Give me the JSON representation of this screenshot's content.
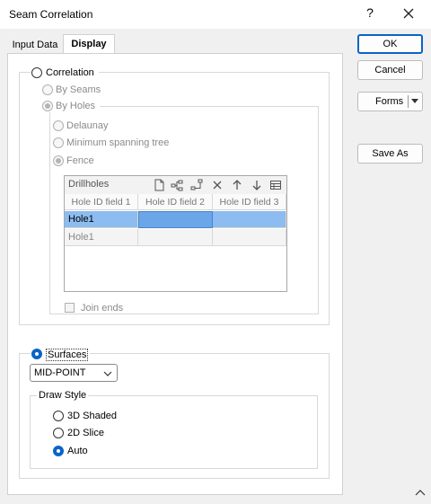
{
  "window": {
    "title": "Seam Correlation",
    "help_label": "?"
  },
  "tabs": [
    {
      "label": "Input Data"
    },
    {
      "label": "Display"
    }
  ],
  "correlation": {
    "label": "Correlation",
    "by_seams": "By Seams",
    "by_holes": "By Holes",
    "methods": {
      "delaunay": "Delaunay",
      "mst": "Minimum spanning tree",
      "fence": "Fence"
    },
    "drillholes": {
      "title": "Drillholes",
      "columns": [
        "Hole ID field 1",
        "Hole ID field 2",
        "Hole ID field 3"
      ],
      "rows": [
        [
          "Hole1",
          "",
          ""
        ],
        [
          "Hole1",
          "",
          ""
        ]
      ]
    },
    "join_ends": "Join ends"
  },
  "surfaces": {
    "label": "Surfaces",
    "dropdown_value": "MID-POINT",
    "draw_style": {
      "label": "Draw Style",
      "options": [
        "3D Shaded",
        "2D Slice",
        "Auto"
      ],
      "selected": "Auto"
    }
  },
  "buttons": {
    "ok": "OK",
    "cancel": "Cancel",
    "forms": "Forms",
    "save_as": "Save As"
  },
  "icons": {
    "new": "new-file-icon",
    "tree": "tree-icon",
    "tree2": "tree-link-icon",
    "delete": "delete-icon",
    "up": "arrow-up-icon",
    "down": "arrow-down-icon",
    "table": "table-icon"
  },
  "colors": {
    "accent": "#0a64c8",
    "row_selected": "#8cbcf0"
  }
}
